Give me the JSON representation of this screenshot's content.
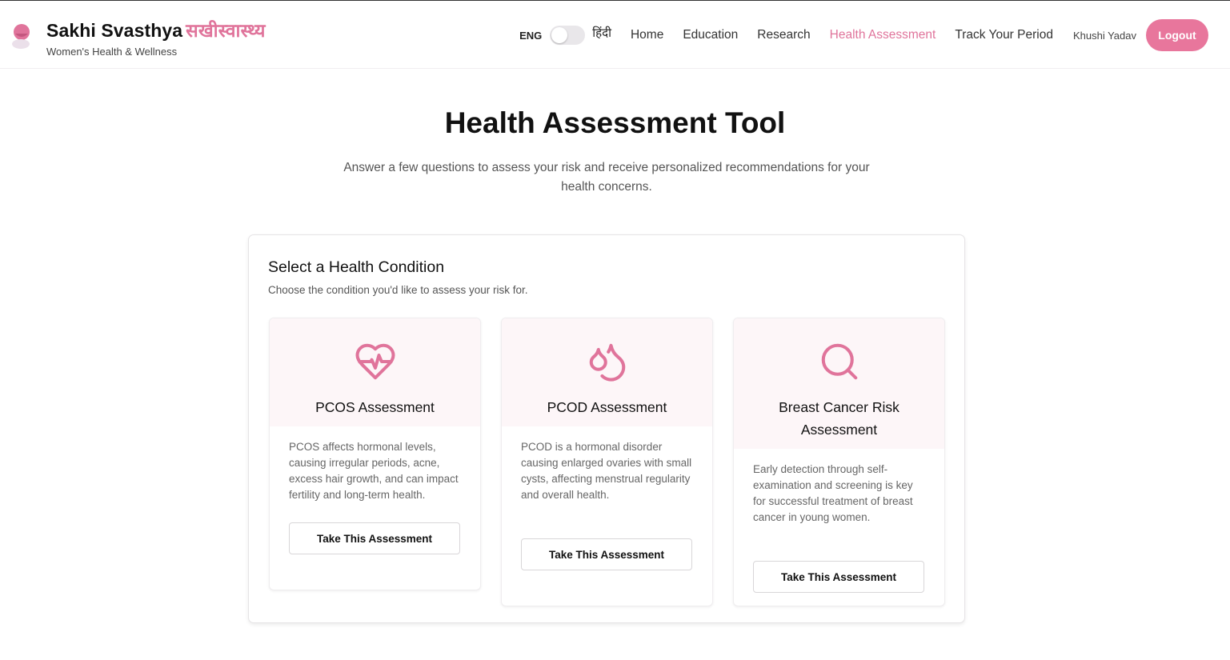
{
  "header": {
    "brand_name": "Sakhi Svasthya",
    "brand_name_hindi": "सखीस्वास्थ्य",
    "tagline": "Women's Health & Wellness",
    "lang_eng": "ENG",
    "lang_hindi": "हिंदी",
    "nav": [
      {
        "label": "Home"
      },
      {
        "label": "Education"
      },
      {
        "label": "Research"
      },
      {
        "label": "Health Assessment",
        "active": true
      },
      {
        "label": "Track Your Period"
      }
    ],
    "user_name": "Khushi Yadav",
    "logout_label": "Logout"
  },
  "hero": {
    "title": "Health Assessment Tool",
    "description": "Answer a few questions to assess your risk and receive personalized recommendations for your health concerns."
  },
  "panel": {
    "title": "Select a Health Condition",
    "subtitle": "Choose the condition you'd like to assess your risk for.",
    "cards": [
      {
        "icon": "heart-pulse-icon",
        "title": "PCOS Assessment",
        "description": "PCOS affects hormonal levels, causing irregular periods, acne, excess hair growth, and can impact fertility and long-term health.",
        "button": "Take This Assessment"
      },
      {
        "icon": "droplets-icon",
        "title": "PCOD Assessment",
        "description": "PCOD is a hormonal disorder causing enlarged ovaries with small cysts, affecting menstrual regularity and overall health.",
        "button": "Take This Assessment"
      },
      {
        "icon": "search-icon",
        "title": "Breast Cancer Risk Assessment",
        "description": "Early detection through self-examination and screening is key for successful treatment of breast cancer in young women.",
        "button": "Take This Assessment"
      }
    ]
  },
  "colors": {
    "accent": "#e8769c",
    "card_header_bg": "#fdf6f8"
  }
}
